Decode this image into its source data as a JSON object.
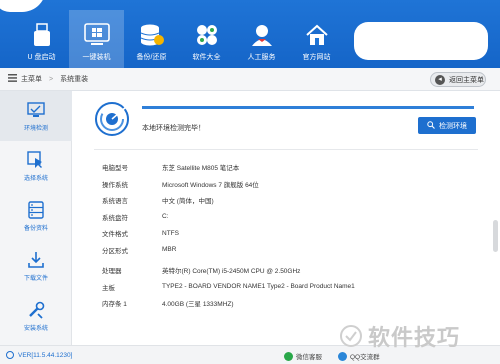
{
  "header": {
    "nav": [
      {
        "label": "U 盘启动",
        "icon": "usb-drive-icon",
        "active": false
      },
      {
        "label": "一键装机",
        "icon": "monitor-windows-icon",
        "active": true
      },
      {
        "label": "备份/还原",
        "icon": "database-backup-icon",
        "active": false
      },
      {
        "label": "软件大全",
        "icon": "apps-grid-icon",
        "active": false
      },
      {
        "label": "人工服务",
        "icon": "support-person-icon",
        "active": false
      },
      {
        "label": "官方网站",
        "icon": "home-icon",
        "active": false
      }
    ]
  },
  "breadcrumb": {
    "home": "主菜单",
    "current": "系统重装",
    "back_label": "返回主菜单"
  },
  "sidebar": {
    "items": [
      {
        "label": "环境检测",
        "icon": "env-check-icon",
        "active": true
      },
      {
        "label": "选择系统",
        "icon": "select-system-icon",
        "active": false
      },
      {
        "label": "备份资料",
        "icon": "backup-data-icon",
        "active": false
      },
      {
        "label": "下载文件",
        "icon": "download-icon",
        "active": false
      },
      {
        "label": "安装系统",
        "icon": "install-tools-icon",
        "active": false
      }
    ]
  },
  "main": {
    "status_text": "本地环境检测完毕！",
    "detect_button": "检测环境",
    "info": [
      {
        "key": "电脑型号",
        "value": "东芝 Satellite M805 笔记本"
      },
      {
        "key": "操作系统",
        "value": "Microsoft Windows 7 旗舰版  64位"
      },
      {
        "key": "系统语言",
        "value": "中文 (简体，中国)"
      },
      {
        "key": "系统盘符",
        "value": "C:"
      },
      {
        "key": "文件格式",
        "value": "NTFS"
      },
      {
        "key": "分区形式",
        "value": "MBR"
      },
      {
        "key": "处理器",
        "value": "英特尔(R) Core(TM) i5-2450M CPU @ 2.50GHz"
      },
      {
        "key": "主板",
        "value": "TYPE2 - BOARD VENDOR NAME1 Type2 - Board Product Name1"
      },
      {
        "key": "内存条 1",
        "value": "4.00GB (三星 1333MHZ)"
      }
    ]
  },
  "footer": {
    "version": "VER[11.5.44.1230]",
    "wechat": "微信客服",
    "qq": "QQ交流群"
  },
  "watermark": {
    "text": "软件技巧"
  },
  "colors": {
    "brand_blue": "#1e6fcf",
    "header_blue": "#1f74d6"
  }
}
